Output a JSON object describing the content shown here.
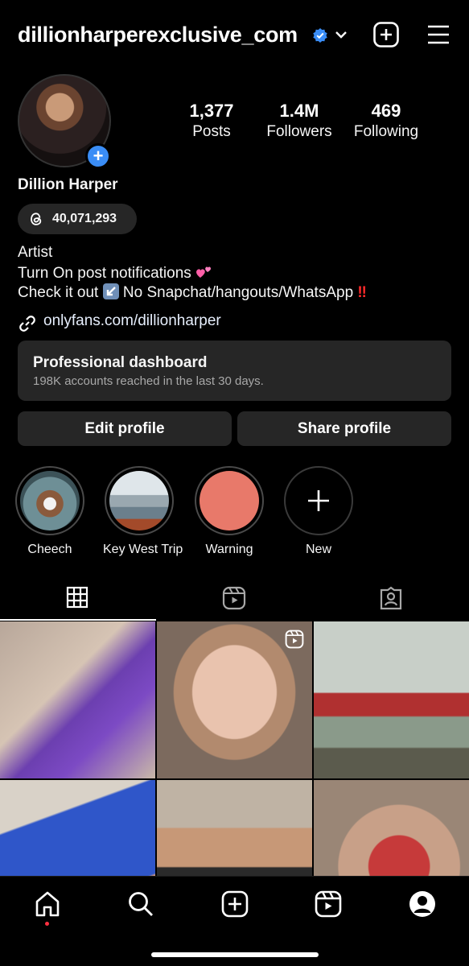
{
  "header": {
    "username": "dillionharperexclusive_com",
    "icons": [
      "verified-badge-icon",
      "chevron-down-icon",
      "create-post-icon",
      "menu-icon"
    ]
  },
  "profile": {
    "full_name": "Dillion Harper",
    "threads_count": "40,071,293",
    "stats": [
      {
        "value": "1,377",
        "label": "Posts"
      },
      {
        "value": "1.4M",
        "label": "Followers"
      },
      {
        "value": "469",
        "label": "Following"
      }
    ],
    "bio": {
      "line1": "Artist",
      "line2": "Turn On post notifications",
      "line3": "Check it out",
      "line3_rest": "No Snapchat/hangouts/WhatsApp",
      "link": "onlyfans.com/dillionharper"
    }
  },
  "dashboard": {
    "title": "Professional dashboard",
    "subtitle": "198K accounts reached in the last 30 days."
  },
  "buttons": {
    "edit": "Edit profile",
    "share": "Share profile"
  },
  "highlights": [
    {
      "label": "Cheech"
    },
    {
      "label": "Key West Trip"
    },
    {
      "label": "Warning"
    },
    {
      "label": "New"
    }
  ],
  "tabs": [
    "grid-icon",
    "reels-icon",
    "tagged-icon"
  ],
  "colors": {
    "accent_blue": "#3a8df6",
    "surface": "#262626",
    "warning_highlight": "#e8796a",
    "notification_dot": "#ff3040"
  },
  "bottom_nav": [
    "home-icon",
    "search-icon",
    "create-icon",
    "reels-icon",
    "profile-icon"
  ]
}
